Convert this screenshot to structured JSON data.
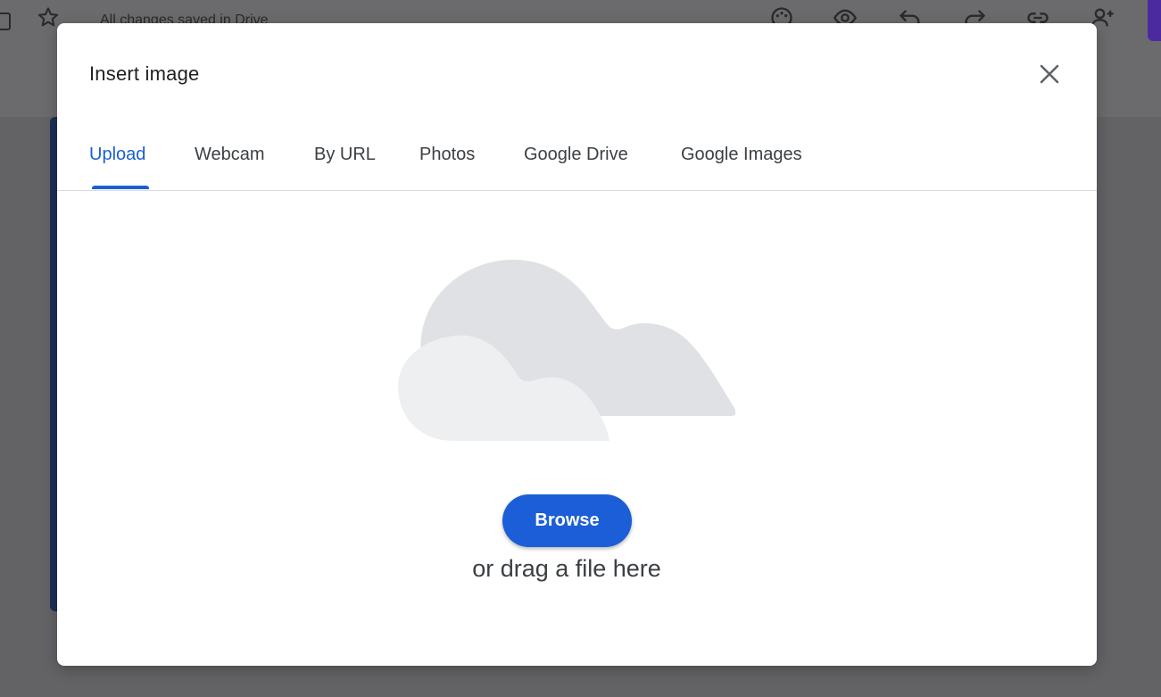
{
  "background": {
    "status_text": "All changes saved in Drive",
    "toolbar_icons": [
      "square-icon",
      "star-icon",
      "palette-icon",
      "eye-icon",
      "undo-icon",
      "redo-icon",
      "link-icon",
      "add-person-icon"
    ]
  },
  "dialog": {
    "title": "Insert image",
    "close_icon": "close-icon",
    "tabs": [
      {
        "label": "Upload",
        "active": true
      },
      {
        "label": "Webcam",
        "active": false
      },
      {
        "label": "By URL",
        "active": false
      },
      {
        "label": "Photos",
        "active": false
      },
      {
        "label": "Google Drive",
        "active": false
      },
      {
        "label": "Google Images",
        "active": false
      }
    ],
    "illustration": "cloud-upload-icon",
    "browse_label": "Browse",
    "drag_text": "or drag a file here"
  },
  "colors": {
    "accent": "#1a5fd0",
    "button": "#1b5ed7",
    "cloud_back": "#e0e1e5",
    "cloud_front": "#eeeff1"
  }
}
